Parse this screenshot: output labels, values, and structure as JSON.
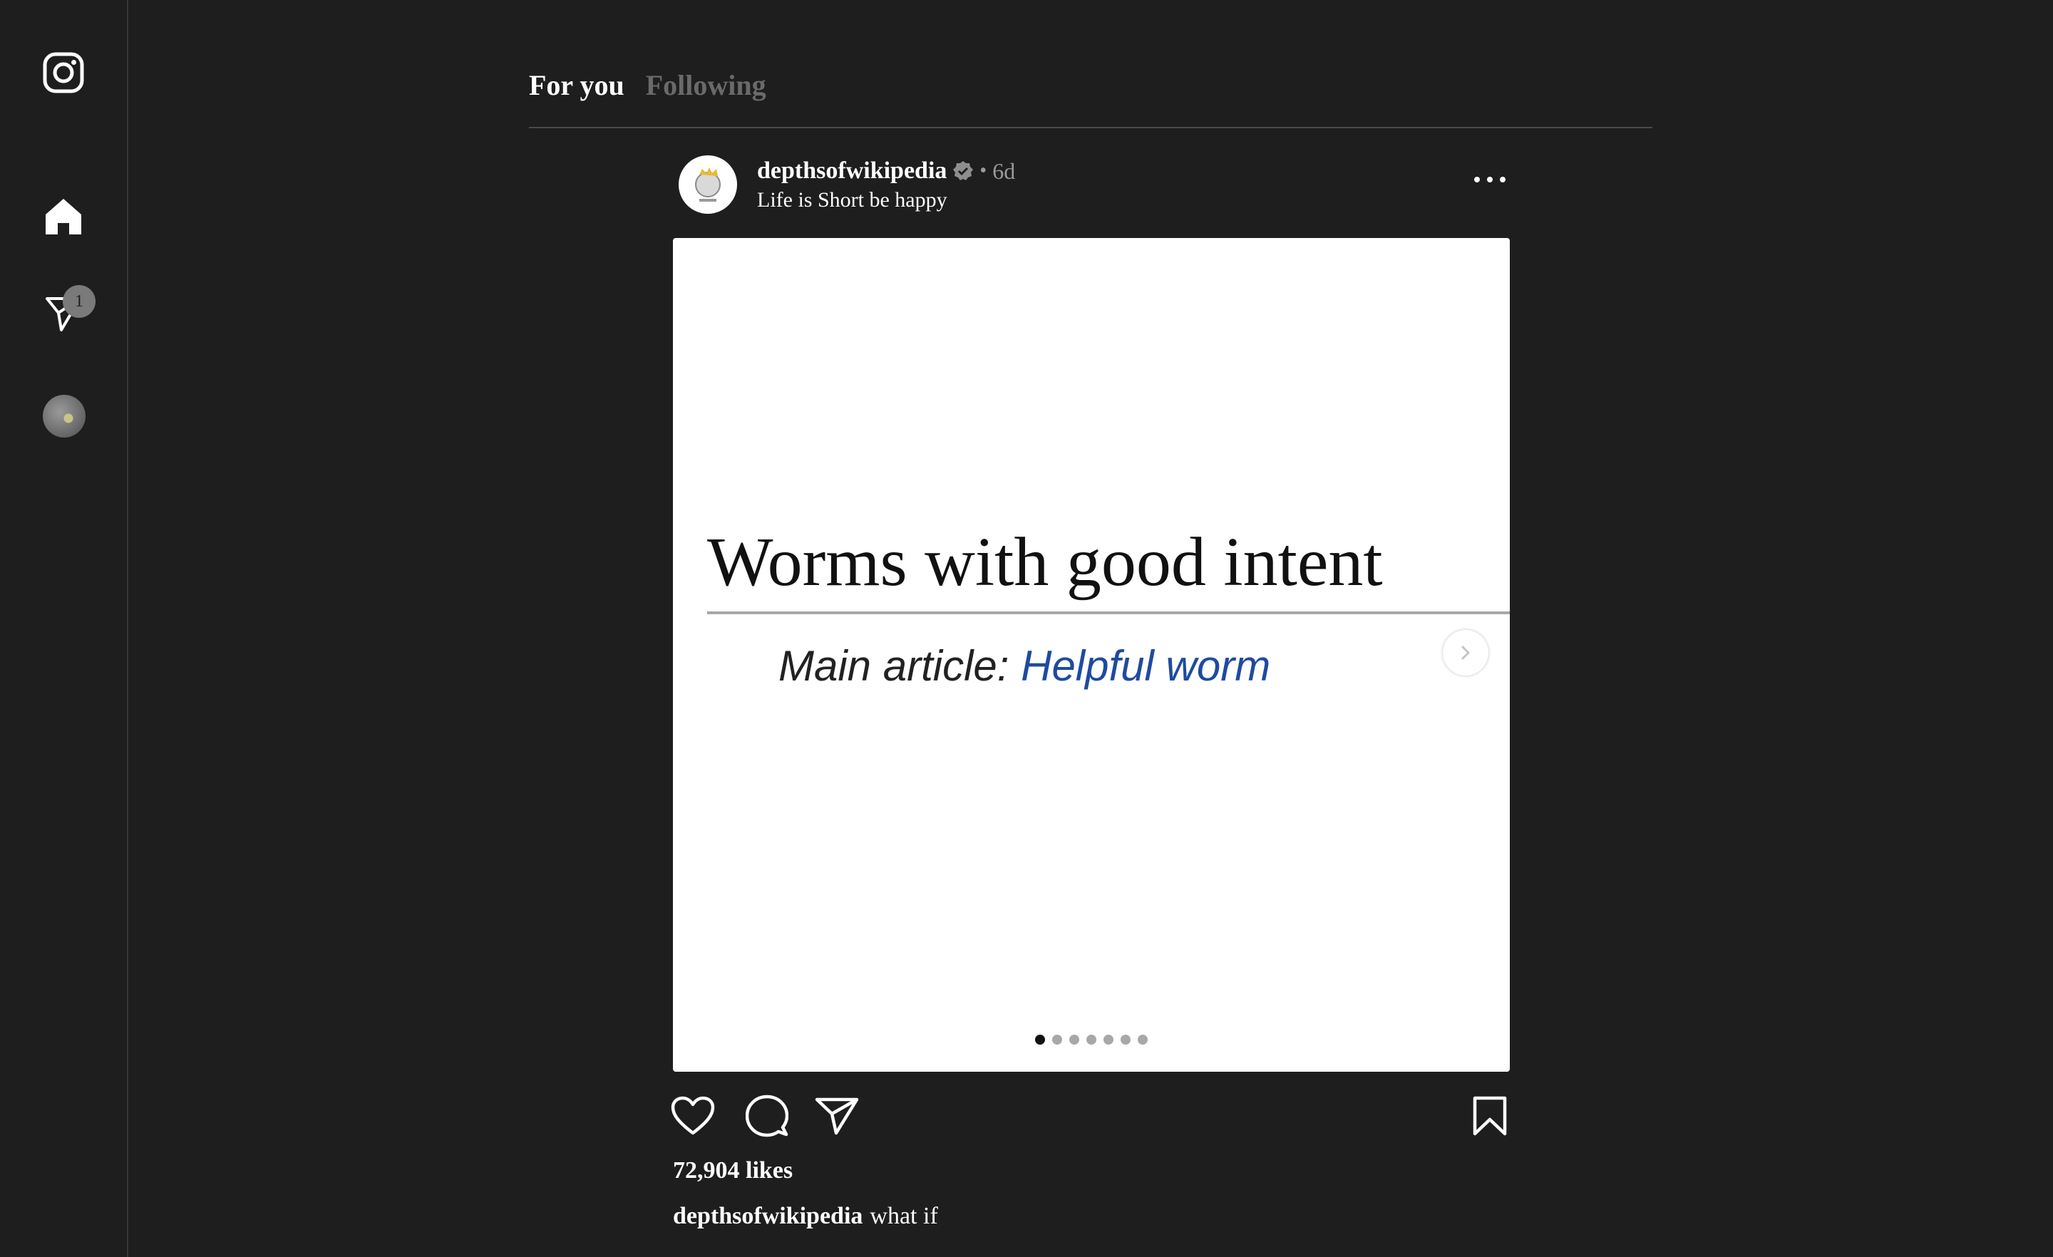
{
  "sidebar": {
    "items": [
      {
        "icon": "instagram-logo-icon"
      },
      {
        "icon": "home-icon"
      },
      {
        "icon": "direct-message-icon",
        "badge": "1"
      },
      {
        "icon": "profile-avatar"
      }
    ]
  },
  "tabs": [
    {
      "label": "For you",
      "active": true
    },
    {
      "label": "Following",
      "active": false
    }
  ],
  "post": {
    "username": "depthsofwikipedia",
    "verified": true,
    "separator": "•",
    "time_ago": "6d",
    "subtitle": "Life is Short be happy",
    "image": {
      "heading": "Worms with good intent",
      "main_prefix": "Main article: ",
      "main_link": "Helpful worm",
      "slide_count": 7,
      "active_slide": 1
    },
    "likes": "72,904 likes",
    "caption_user": "depthsofwikipedia",
    "caption_text": "what if"
  },
  "colors": {
    "background": "#1e1e1e",
    "text": "#f5f5f5",
    "muted": "#6a6a6a",
    "link": "#1f4aa0"
  }
}
